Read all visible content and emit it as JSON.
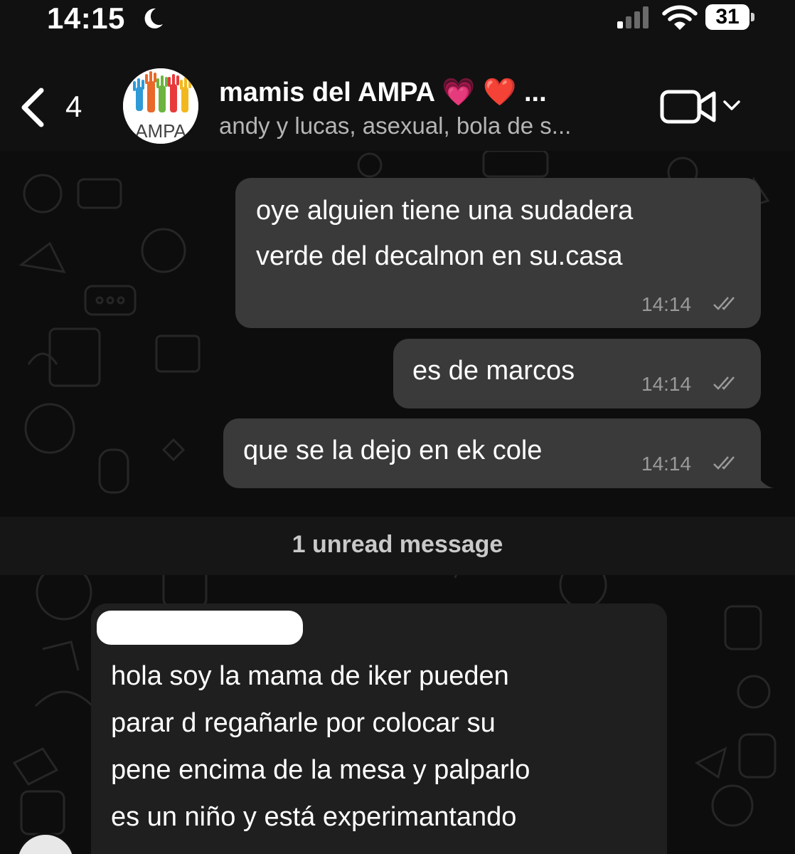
{
  "status_bar": {
    "time": "14:15",
    "battery_level": "31",
    "icons": [
      "moon-icon",
      "signal-icon",
      "wifi-icon",
      "battery-icon"
    ]
  },
  "header": {
    "back_count": "4",
    "avatar_text": "AMPA",
    "group_name": "mamis del AMPA",
    "group_name_emojis": "💗 ❤️ ...",
    "members": "andy y lucas, asexual, bola de s...",
    "icons": [
      "back-icon",
      "video-call-icon",
      "chevron-down-icon"
    ]
  },
  "messages": [
    {
      "direction": "outgoing",
      "lines": [
        "oye alguien tiene una sudadera",
        "verde del decalnon en su.casa"
      ],
      "time": "14:14",
      "status": "read"
    },
    {
      "direction": "outgoing",
      "lines": [
        "es de marcos"
      ],
      "time": "14:14",
      "status": "read"
    },
    {
      "direction": "outgoing",
      "lines": [
        "que se la dejo en ek cole"
      ],
      "time": "14:14",
      "status": "read"
    },
    {
      "direction": "incoming",
      "lines": [
        "hola soy la mama de iker pueden",
        "parar d regañarle por colocar su",
        "pene encima de la mesa y palparlo",
        "es un niño y está experimantando"
      ],
      "sender_redacted": true
    }
  ],
  "unread_banner": "1 unread message",
  "colors": {
    "background": "#0d0d0d",
    "outgoing_bubble": "#3a3a3a",
    "incoming_bubble": "#1f1f1f",
    "timestamp": "#9a9a9a"
  }
}
